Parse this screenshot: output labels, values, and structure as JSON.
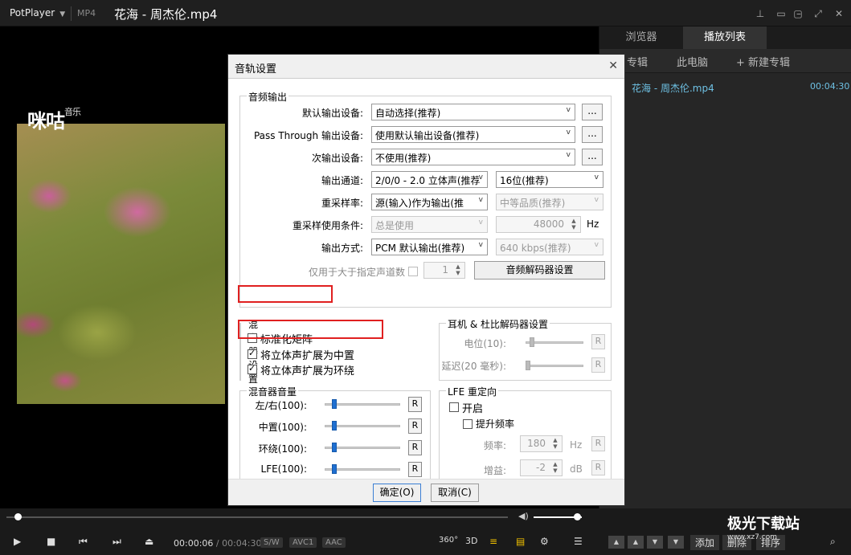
{
  "app": {
    "brand": "PotPlayer",
    "format": "MP4",
    "filename": "花海 - 周杰伦.mp4"
  },
  "video": {
    "logo_text": "咪咕",
    "logo_sub": "音乐"
  },
  "playlist": {
    "tabs": [
      "浏览器",
      "播放列表"
    ],
    "subtabs": [
      "专辑",
      "此电脑",
      "+ 新建专辑"
    ],
    "items": [
      {
        "name": "花海 - 周杰伦.mp4",
        "duration": "00:04:30"
      }
    ],
    "buttons": [
      "添加",
      "删除",
      "排序"
    ]
  },
  "player": {
    "current_time": "00:00:06",
    "total_time": "/ 00:04:30",
    "badges": [
      "S/W",
      "AVC1",
      "AAC"
    ],
    "extra": [
      "360°",
      "3D"
    ],
    "seek_fraction": 0.022,
    "volume_fraction": 0.9
  },
  "watermark": {
    "title": "极光下载站",
    "url": "www.xz7.com"
  },
  "dialog": {
    "title": "音轨设置",
    "audio_output": {
      "group_title": "音频输出",
      "default_device_label": "默认输出设备:",
      "default_device_value": "自动选择(推荐)",
      "passthrough_label": "Pass Through 输出设备:",
      "passthrough_value": "使用默认输出设备(推荐)",
      "secondary_label": "次输出设备:",
      "secondary_value": "不使用(推荐)",
      "channel_label": "输出通道:",
      "channel_value": "2/0/0 - 2.0 立体声(推荐",
      "bits_value": "16位(推荐)",
      "resample_label": "重采样率:",
      "resample_value": "源(输入)作为输出(推",
      "quality_value": "中等品质(推荐)",
      "resample_cond_label": "重采样使用条件:",
      "resample_cond_value": "总是使用",
      "rate_value": "48000",
      "rate_unit": "Hz",
      "method_label": "输出方式:",
      "method_value": "PCM 默认输出(推荐)",
      "bitrate_value": "640 kbps(推荐)",
      "only_channels_label": "仅用于大于指定声道数",
      "only_channels_value": "1",
      "decoder_button": "音频解码器设置",
      "dots": "..."
    },
    "mixer": {
      "group_title": "混音器设置",
      "normalize": "标准化矩阵",
      "expand_center": "将立体声扩展为中置",
      "expand_surround": "将立体声扩展为环绕"
    },
    "headphone": {
      "group_title": "耳机 & 杜比解码器设置",
      "level_label": "电位(10):",
      "delay_label": "延迟(20 毫秒):",
      "reset": "R"
    },
    "mixer_volume": {
      "group_title": "混音器音量",
      "rows": [
        {
          "label": "左/右(100):",
          "level": 0.1
        },
        {
          "label": "中置(100):",
          "level": 0.1
        },
        {
          "label": "环绕(100):",
          "level": 0.1
        },
        {
          "label": "LFE(100):",
          "level": 0.1
        }
      ],
      "reset": "R"
    },
    "lfe": {
      "group_title": "LFE 重定向",
      "enable": "开启",
      "raise_freq": "提升频率",
      "freq_label": "频率:",
      "freq_value": "180",
      "freq_unit": "Hz",
      "gain_label": "增益:",
      "gain_value": "-2",
      "gain_unit": "dB",
      "reset": "R"
    },
    "ok": "确定(O)",
    "cancel": "取消(C)"
  }
}
